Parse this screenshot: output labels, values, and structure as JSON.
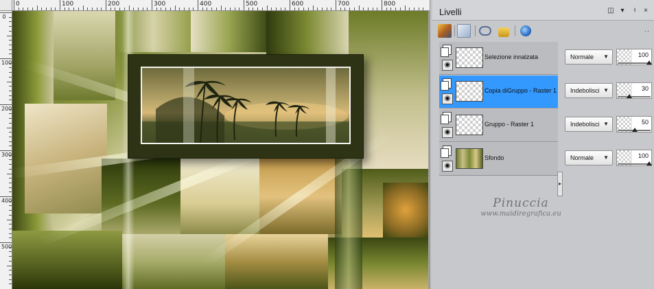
{
  "ruler": {
    "h_labels": [
      "0",
      "100",
      "200",
      "300",
      "400",
      "500",
      "600",
      "700",
      "800"
    ],
    "v_labels": [
      "0",
      "100",
      "200",
      "300",
      "400",
      "500"
    ]
  },
  "panel": {
    "title": "Livelli",
    "header_icons": [
      "restore-icon",
      "menu-arrow-icon",
      "pin-icon",
      "close-icon"
    ],
    "toolbar_icons": [
      "layer-brush-icon",
      "new-layer-icon",
      "link-icon",
      "lock-icon",
      "layer-properties-icon"
    ],
    "toolbar_more": "··"
  },
  "layers": [
    {
      "name": "Selezione innalzata",
      "selected": false,
      "blend": "Normale",
      "opacity": "100",
      "opacity_value": 100
    },
    {
      "name": "Copia diGruppo - Raster 1",
      "selected": true,
      "blend": "Indebolisci",
      "opacity": "30",
      "opacity_value": 30
    },
    {
      "name": "Gruppo - Raster 1",
      "selected": false,
      "blend": "Indebolisci",
      "opacity": "50",
      "opacity_value": 50
    },
    {
      "name": "Sfondo",
      "selected": false,
      "blend": "Normale",
      "opacity": "100",
      "opacity_value": 100
    }
  ],
  "watermark": {
    "name": "Pinuccia",
    "url": "www.maidiregrafica.eu"
  },
  "colors": {
    "selection": "#3399ff",
    "panel_bg": "#c6c8cb",
    "row_bg": "#babcbf"
  }
}
